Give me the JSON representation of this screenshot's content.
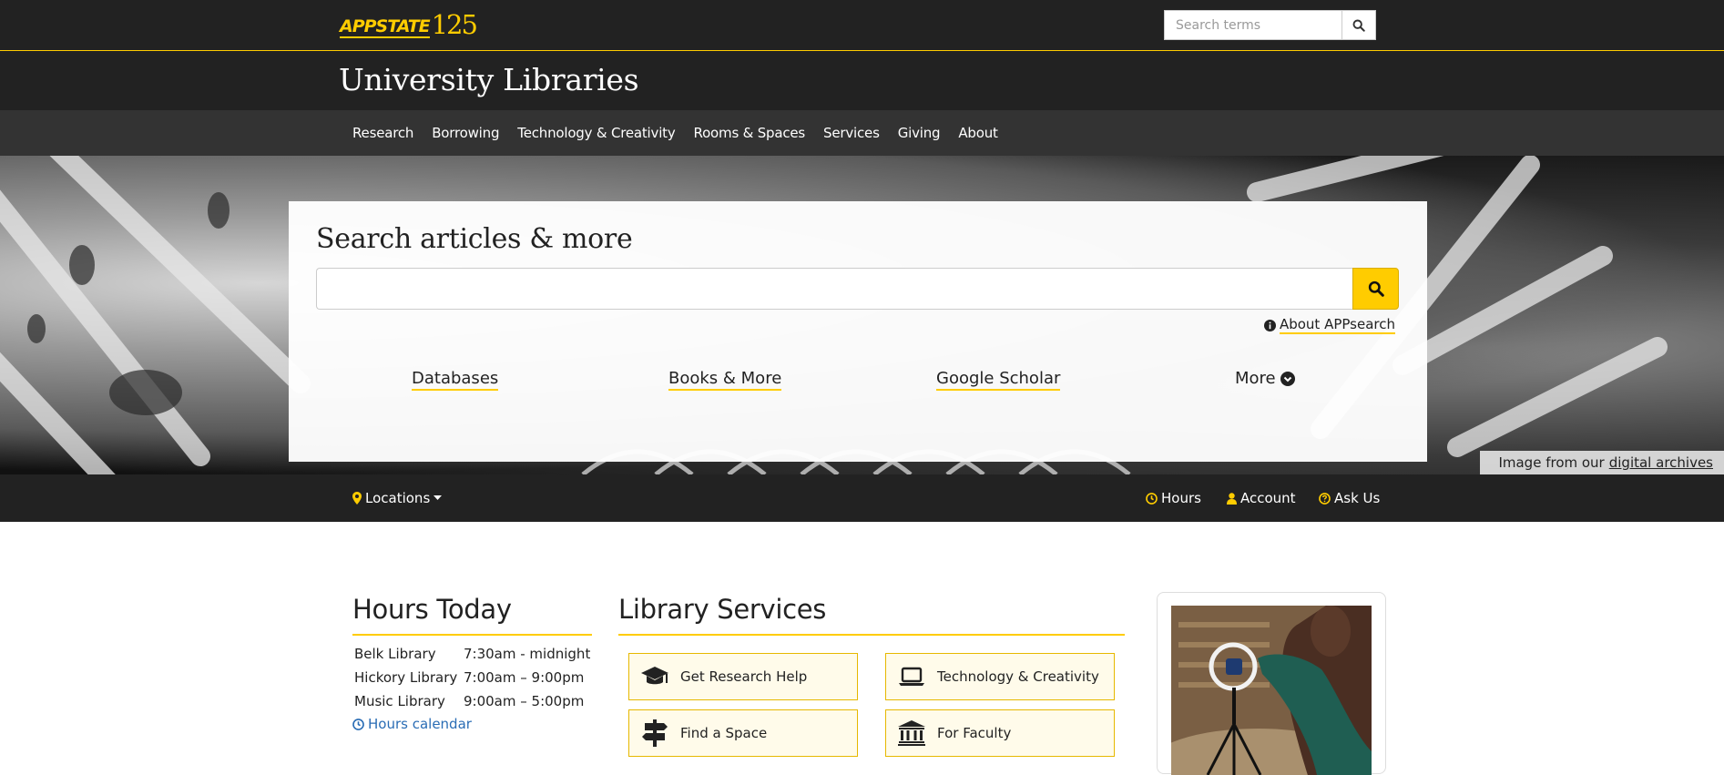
{
  "topbar": {
    "logo": {
      "text_app": "APPSTATE",
      "text_num": "125"
    },
    "search": {
      "placeholder": "Search terms"
    }
  },
  "header": {
    "title": "University Libraries"
  },
  "nav": {
    "items": [
      "Research",
      "Borrowing",
      "Technology & Creativity",
      "Rooms & Spaces",
      "Services",
      "Giving",
      "About"
    ]
  },
  "hero": {
    "heading": "Search articles & more",
    "about_link": "About APPsearch",
    "links": {
      "databases": "Databases",
      "books": "Books & More",
      "scholar": "Google Scholar",
      "more": "More"
    },
    "credit": {
      "prefix": "Image from our",
      "link": "digital archives"
    }
  },
  "utility": {
    "locations": "Locations",
    "hours": "Hours",
    "account": "Account",
    "ask": "Ask Us"
  },
  "hours_today": {
    "title": "Hours Today",
    "rows": [
      {
        "location": "Belk Library",
        "hours": "7:30am - midnight"
      },
      {
        "location": "Hickory Library",
        "hours": "7:00am – 9:00pm"
      },
      {
        "location": "Music Library",
        "hours": "9:00am – 5:00pm"
      }
    ],
    "calendar_link": "Hours calendar"
  },
  "services": {
    "title": "Library Services",
    "buttons": [
      {
        "label": "Get Research Help",
        "icon": "graduation-cap-icon"
      },
      {
        "label": "Technology & Creativity",
        "icon": "laptop-icon"
      },
      {
        "label": "Find a Space",
        "icon": "signpost-icon"
      },
      {
        "label": "For Faculty",
        "icon": "institution-icon"
      }
    ]
  },
  "colors": {
    "accent": "#ffcc00",
    "dark": "#222222",
    "nav": "#333333",
    "link": "#2a6db5"
  }
}
